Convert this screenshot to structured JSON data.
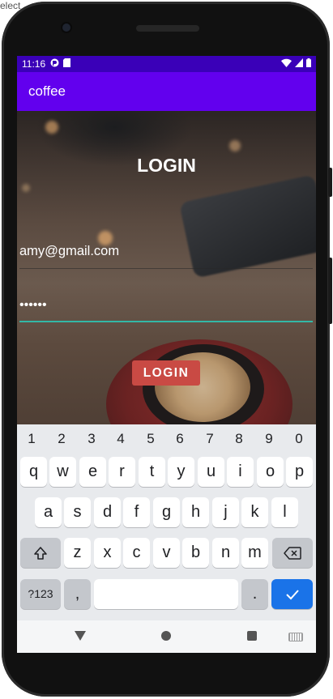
{
  "window": {
    "top_label": "elect"
  },
  "status_bar": {
    "time": "11:16",
    "left_icons": [
      "app-notification-icon",
      "sd-card-icon"
    ],
    "right_icons": [
      "wifi-icon",
      "signal-icon",
      "battery-icon"
    ]
  },
  "app_bar": {
    "title": "coffee"
  },
  "login": {
    "heading": "LOGIN",
    "email_value": "amy@gmail.com",
    "password_value": "••••••",
    "button_label": "LOGIN"
  },
  "keyboard": {
    "number_row": [
      "1",
      "2",
      "3",
      "4",
      "5",
      "6",
      "7",
      "8",
      "9",
      "0"
    ],
    "row1": [
      "q",
      "w",
      "e",
      "r",
      "t",
      "y",
      "u",
      "i",
      "o",
      "p"
    ],
    "row2": [
      "a",
      "s",
      "d",
      "f",
      "g",
      "h",
      "j",
      "k",
      "l"
    ],
    "row3": [
      "z",
      "x",
      "c",
      "v",
      "b",
      "n",
      "m"
    ],
    "symbols_label": "?123",
    "comma_label": ",",
    "period_label": "."
  },
  "colors": {
    "status_bar": "#3a00b8",
    "app_bar": "#6200ee",
    "login_button": "#c94a44",
    "password_underline": "#33b7a6",
    "enter_key": "#1a73e8"
  }
}
